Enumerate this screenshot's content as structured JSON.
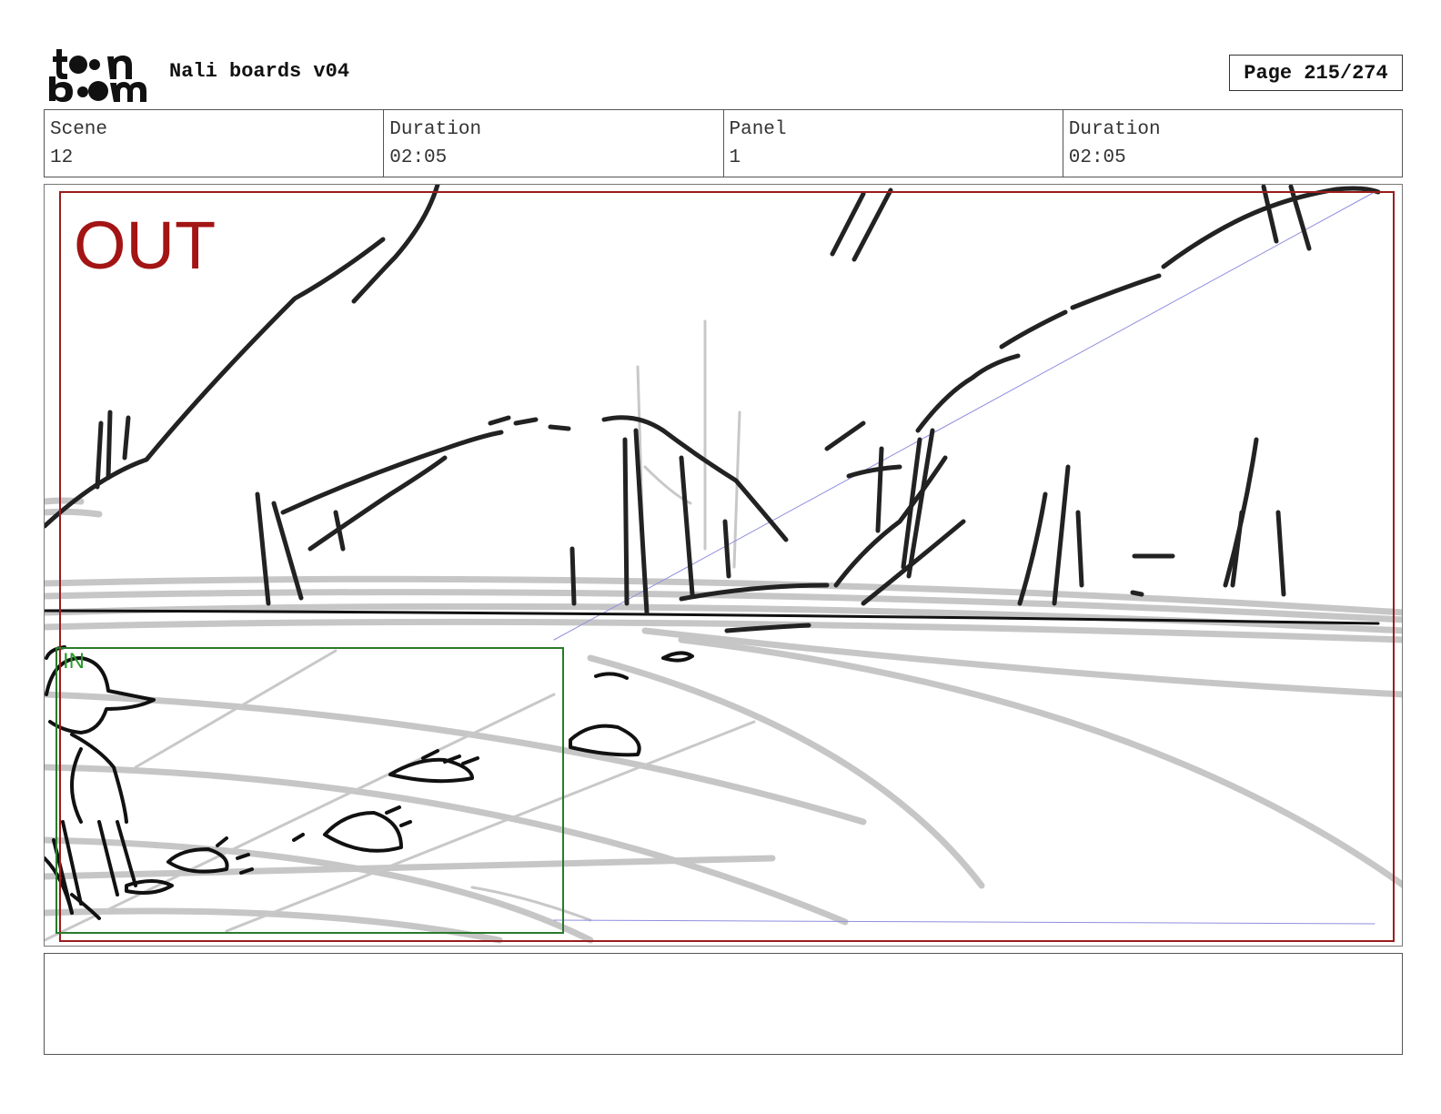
{
  "header": {
    "logo_text_top": "toon",
    "logo_text_bottom": "boom",
    "title": "Nali boards v04",
    "page_label": "Page 215/274"
  },
  "info": {
    "scene_label": "Scene",
    "scene_value": "12",
    "scene_duration_label": "Duration",
    "scene_duration_value": "02:05",
    "panel_label": "Panel",
    "panel_value": "1",
    "panel_duration_label": "Duration",
    "panel_duration_value": "02:05"
  },
  "panel": {
    "out_label": "OUT",
    "in_label": "IN",
    "out_color": "#a31414",
    "in_color": "#2a9a2a"
  },
  "notes": {
    "text": ""
  }
}
